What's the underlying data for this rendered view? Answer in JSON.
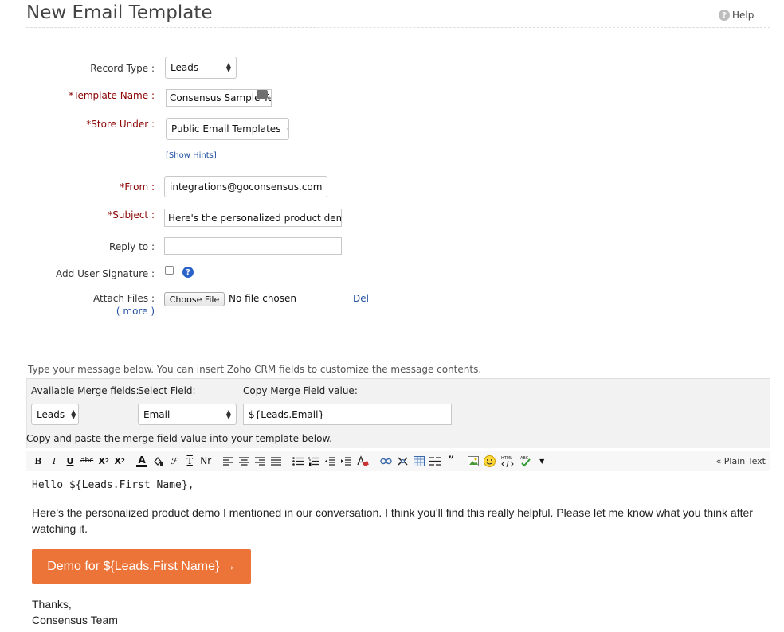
{
  "header": {
    "title": "New Email Template",
    "help_label": "Help"
  },
  "form": {
    "record_type": {
      "label": "Record Type :",
      "value": "Leads"
    },
    "template_name": {
      "required": "*",
      "label": "Template Name :",
      "value": "Consensus Sample Ten"
    },
    "store_under": {
      "required": "*",
      "label": "Store Under :",
      "value": "Public Email Templates"
    },
    "show_hints": "[Show Hints]",
    "from": {
      "required": "*",
      "label": "From :",
      "value": "integrations@goconsensus.com"
    },
    "subject": {
      "required": "*",
      "label": "Subject :",
      "value": "Here's the personalized product demo"
    },
    "reply_to": {
      "label": "Reply to :",
      "value": ""
    },
    "signature": {
      "label": "Add User Signature :",
      "checked": false
    },
    "attach": {
      "label": "Attach Files :",
      "more": "( more )",
      "button": "Choose File",
      "status": "No file chosen",
      "delete": "Del"
    }
  },
  "merge": {
    "instructions": "Type your message below. You can insert Zoho CRM fields to customize the message contents.",
    "available_label": "Available Merge fields:",
    "available_value": "Leads",
    "select_label": "Select Field:",
    "select_value": "Email",
    "copy_label": "Copy Merge Field value:",
    "copy_value": "${Leads.Email}",
    "note": "Copy and paste the merge field value into your template below."
  },
  "toolbar": {
    "plain_text": "« Plain Text"
  },
  "message": {
    "greeting": "Hello ${Leads.First Name},",
    "paragraph": "Here's the personalized product demo I mentioned in our conversation. I think you'll find this really helpful. Please let me know what you think after watching it.",
    "button": "Demo for ${Leads.First Name} →",
    "button_color": "#ed7438",
    "closing": "Thanks,",
    "signature": "Consensus Team"
  }
}
